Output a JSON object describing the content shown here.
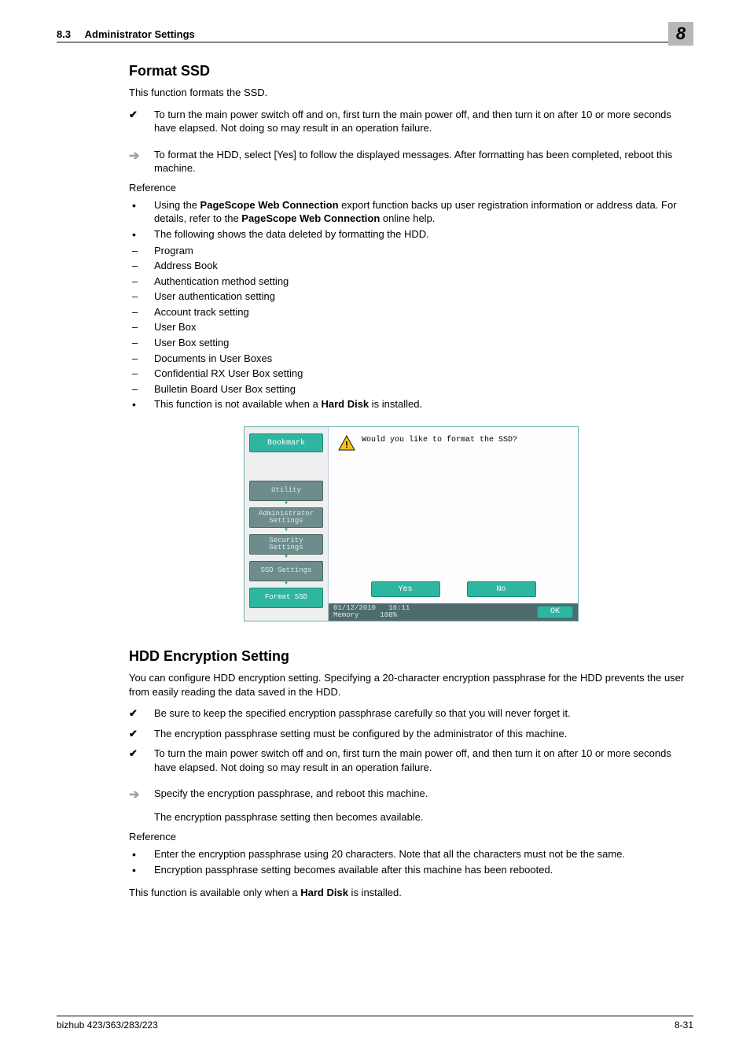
{
  "header": {
    "section_number": "8.3",
    "section_title": "Administrator Settings",
    "chapter_number": "8"
  },
  "s1": {
    "title": "Format SSD",
    "intro": "This function formats the SSD.",
    "check1": "To turn the main power switch off and on, first turn the main power off, and then turn it on after 10 or more seconds have elapsed. Not doing so may result in an operation failure.",
    "arrow1": "To format the HDD, select [Yes] to follow the displayed messages. After formatting has been completed, reboot this machine.",
    "reference_label": "Reference",
    "ref1_a": "Using the ",
    "ref1_b": "PageScope Web Connection",
    "ref1_c": " export function backs up user registration information or address data. For details, refer to the ",
    "ref1_d": "PageScope Web Connection",
    "ref1_e": " online help.",
    "ref2": "The following shows the data deleted by formatting the HDD.",
    "d1": "Program",
    "d2": "Address Book",
    "d3": "Authentication method setting",
    "d4": "User authentication setting",
    "d5": "Account track setting",
    "d6": "User Box",
    "d7": "User Box setting",
    "d8": "Documents in User Boxes",
    "d9": "Confidential RX User Box setting",
    "d10": "Bulletin Board User Box setting",
    "ref3_a": "This function is not available when a ",
    "ref3_b": "Hard Disk",
    "ref3_c": " is installed."
  },
  "screenshot": {
    "bookmark": "Bookmark",
    "crumb1": "Utility",
    "crumb2": "Administrator\nSettings",
    "crumb3": "Security\nSettings",
    "crumb4": "SSD Settings",
    "crumb5": "Format SSD",
    "prompt": "Would you like to format the SSD?",
    "yes": "Yes",
    "no": "No",
    "date": "01/12/2010",
    "time": "16:11",
    "mem_label": "Memory",
    "mem_val": "100%",
    "ok": "OK"
  },
  "s2": {
    "title": "HDD Encryption Setting",
    "intro": "You can configure HDD encryption setting. Specifying a 20-character encryption passphrase for the HDD prevents the user from easily reading the data saved in the HDD.",
    "check1": "Be sure to keep the specified encryption passphrase carefully so that you will never forget it.",
    "check2": "The encryption passphrase setting must be configured by the administrator of this machine.",
    "check3": "To turn the main power switch off and on, first turn the main power off, and then turn it on after 10 or more seconds have elapsed. Not doing so may result in an operation failure.",
    "arrow1": "Specify the encryption passphrase, and reboot this machine.",
    "after_arrow": "The encryption passphrase setting then becomes available.",
    "reference_label": "Reference",
    "ref1": "Enter the encryption passphrase using 20 characters. Note that all the characters must not be the same.",
    "ref2": "Encryption passphrase setting becomes available after this machine has been rebooted.",
    "closing_a": "This function is available only when a ",
    "closing_b": "Hard Disk",
    "closing_c": " is installed."
  },
  "footer": {
    "left": "bizhub 423/363/283/223",
    "right": "8-31"
  }
}
